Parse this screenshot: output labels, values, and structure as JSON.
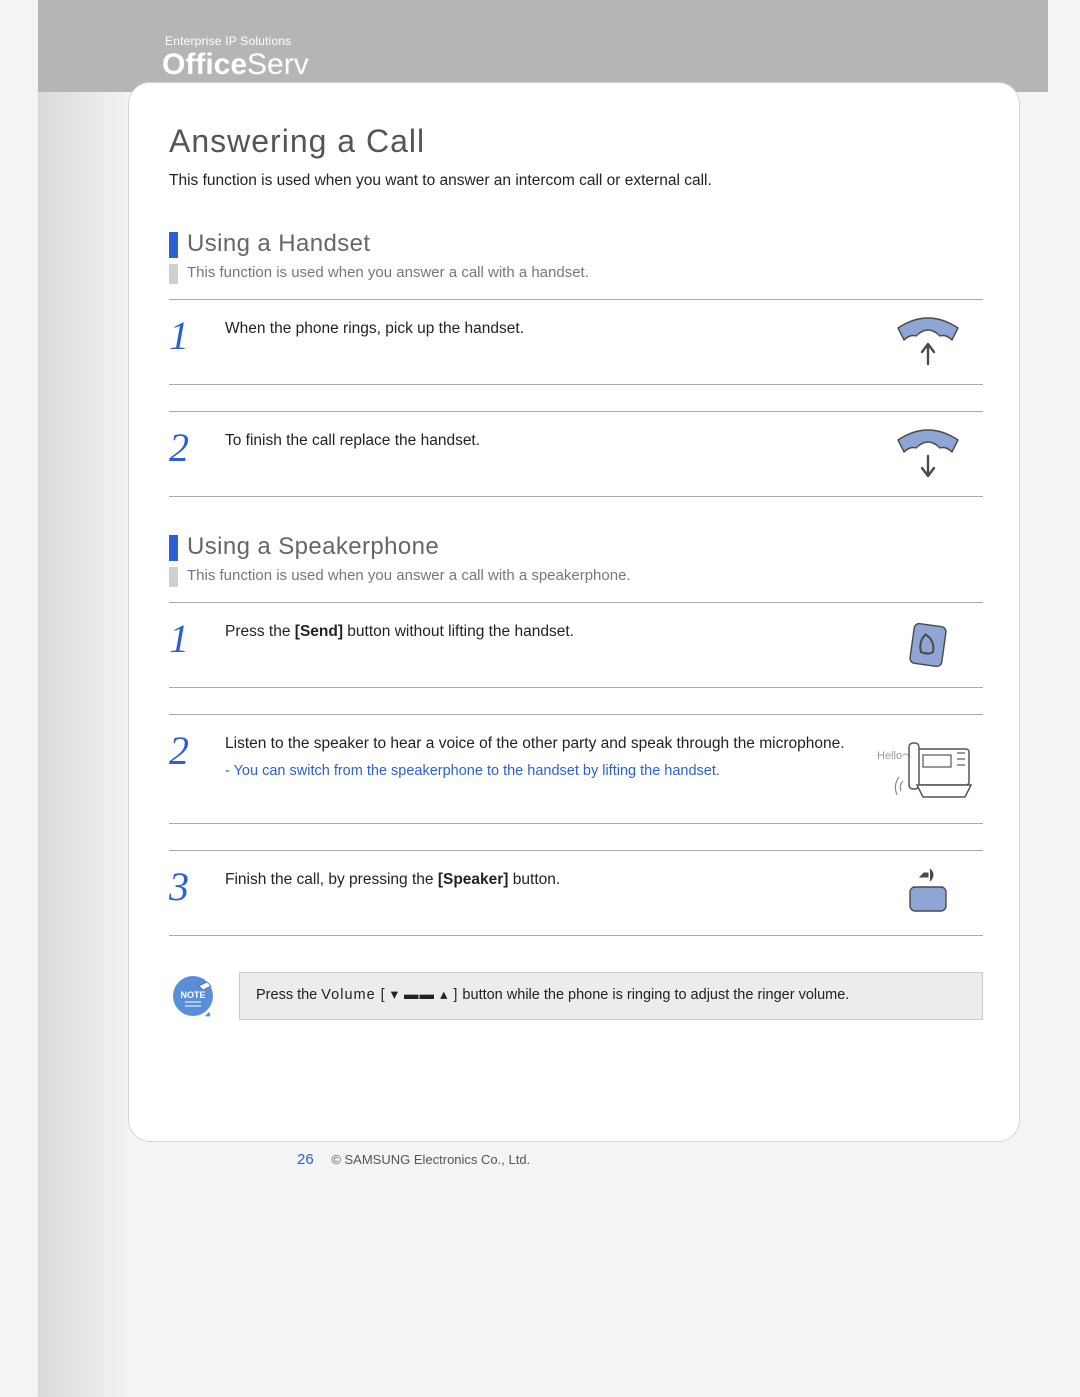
{
  "header": {
    "tagline": "Enterprise IP Solutions",
    "brand_bold": "Office",
    "brand_light": "Serv"
  },
  "page": {
    "title": "Answering a Call",
    "intro": "This function is used when you want to answer an intercom call or external call."
  },
  "sections": {
    "handset": {
      "title": "Using a Handset",
      "desc": "This function is used when you answer a call with a handset.",
      "steps": {
        "s1": {
          "num": "1",
          "text": "When the phone rings, pick up the handset."
        },
        "s2": {
          "num": "2",
          "text": "To finish the call replace the handset."
        }
      }
    },
    "speaker": {
      "title": "Using a Speakerphone",
      "desc": "This function is used when you answer a call with a speakerphone.",
      "steps": {
        "s1": {
          "num": "1",
          "pre": "Press the ",
          "bold": "[Send]",
          "post": " button without lifting the handset."
        },
        "s2": {
          "num": "2",
          "text": "Listen to the speaker to hear a voice of the other party and speak through the microphone.",
          "note": "- You can switch from the speakerphone to the handset by lifting the handset.",
          "hello": "Hello～"
        },
        "s3": {
          "num": "3",
          "pre": "Finish the call, by pressing the ",
          "bold": "[Speaker]",
          "post": " button."
        }
      }
    }
  },
  "note": {
    "badge": "NOTE",
    "pre": "Press the ",
    "vol": "Volume [ ▾ ▬▬ ▴ ]",
    "post": " button while the phone is ringing to adjust the ringer volume."
  },
  "footer": {
    "page_number": "26",
    "copyright": "© SAMSUNG Electronics Co., Ltd."
  },
  "colors": {
    "accent": "#2a5fd8",
    "handset_fill": "#8ea5d6",
    "handset_stroke": "#4a4a4a"
  }
}
